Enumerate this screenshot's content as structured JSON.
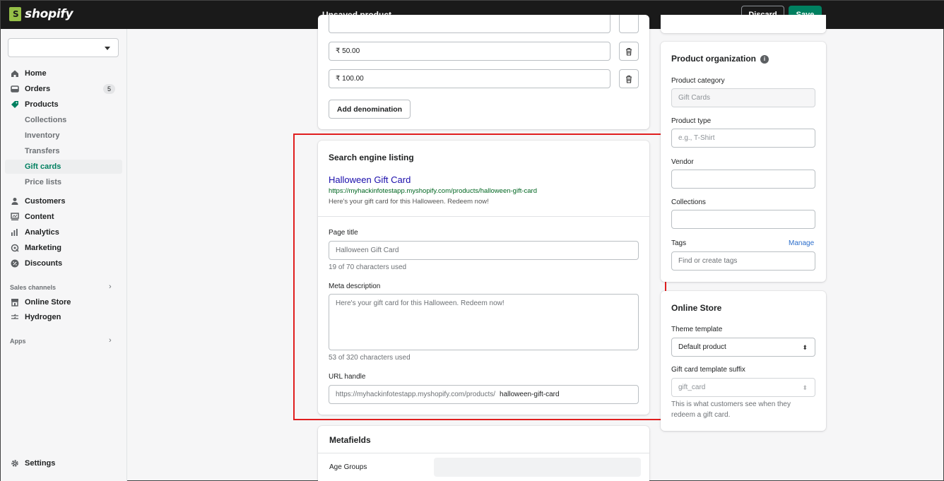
{
  "app": {
    "logo_text": "shopify"
  },
  "header": {
    "title": "Unsaved product",
    "discard_label": "Discard",
    "save_label": "Save"
  },
  "sidebar": {
    "store_select_value": "",
    "items": [
      {
        "label": "Home",
        "icon": "home-icon"
      },
      {
        "label": "Orders",
        "icon": "orders-icon",
        "badge": "5"
      },
      {
        "label": "Products",
        "icon": "tag-icon"
      },
      {
        "label": "Customers",
        "icon": "person-icon"
      },
      {
        "label": "Content",
        "icon": "content-icon"
      },
      {
        "label": "Analytics",
        "icon": "analytics-icon"
      },
      {
        "label": "Marketing",
        "icon": "marketing-icon"
      },
      {
        "label": "Discounts",
        "icon": "discount-icon"
      }
    ],
    "product_sub": [
      "Collections",
      "Inventory",
      "Transfers",
      "Gift cards",
      "Price lists"
    ],
    "sales_channels_label": "Sales channels",
    "channels": [
      {
        "label": "Online Store",
        "icon": "store-icon"
      },
      {
        "label": "Hydrogen",
        "icon": "hydrogen-icon"
      }
    ],
    "apps_label": "Apps",
    "settings_label": "Settings"
  },
  "denominations": {
    "values": [
      "₹ 50.00",
      "₹ 100.00"
    ],
    "add_label": "Add denomination"
  },
  "seo": {
    "heading": "Search engine listing",
    "preview_title": "Halloween Gift Card",
    "preview_url": "https://myhackinfotestapp.myshopify.com/products/halloween-gift-card",
    "preview_desc": "Here's your gift card for this Halloween. Redeem now!",
    "page_title_label": "Page title",
    "page_title_value": "Halloween Gift Card",
    "page_title_help": "19 of 70 characters used",
    "meta_label": "Meta description",
    "meta_value": "Here's your gift card for this Halloween. Redeem now!",
    "meta_help": "53 of 320 characters used",
    "url_label": "URL handle",
    "url_prefix": "https://myhackinfotestapp.myshopify.com/products/",
    "url_value": "halloween-gift-card"
  },
  "metafields": {
    "heading": "Metafields",
    "row_label": "Age Groups"
  },
  "organization": {
    "heading": "Product organization",
    "category_label": "Product category",
    "category_value": "Gift Cards",
    "type_label": "Product type",
    "type_placeholder": "e.g., T-Shirt",
    "vendor_label": "Vendor",
    "collections_label": "Collections",
    "tags_label": "Tags",
    "tags_manage": "Manage",
    "tags_placeholder": "Find or create tags"
  },
  "online_store": {
    "heading": "Online Store",
    "theme_label": "Theme template",
    "theme_value": "Default product",
    "suffix_label": "Gift card template suffix",
    "suffix_value": "gift_card",
    "help_line1": "This is what customers see when they",
    "help_line2": "redeem a gift card."
  },
  "colors": {
    "accent": "#008060",
    "highlight": "#e01e1e",
    "topbar": "#1a1a1a"
  }
}
